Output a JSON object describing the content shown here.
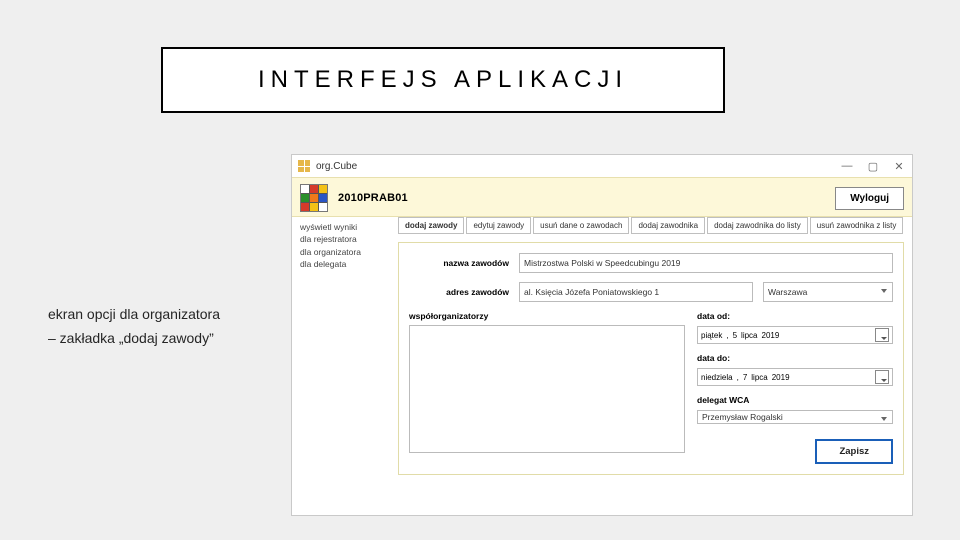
{
  "slide": {
    "title": "INTERFEJS APLIKACJI",
    "caption_line1": "ekran opcji dla organizatora",
    "caption_line2": "– zakładka „dodaj zawody”"
  },
  "app": {
    "window_title": "org.Cube",
    "competition_code": "2010PRAB01",
    "logout": "Wyloguj",
    "cube_colors": [
      "#ffffff",
      "#d63a2a",
      "#f3c116",
      "#2a8f2a",
      "#f07a1a",
      "#2a55c4",
      "#d63a2a",
      "#f3c116",
      "#ffffff"
    ]
  },
  "sidebar": {
    "items": [
      "wyświetl wyniki",
      "dla rejestratora",
      "dla organizatora",
      "dla delegata"
    ]
  },
  "tabs": [
    {
      "label": "dodaj zawody",
      "active": true
    },
    {
      "label": "edytuj zawody",
      "active": false
    },
    {
      "label": "usuń dane o zawodach",
      "active": false
    },
    {
      "label": "dodaj zawodnika",
      "active": false
    },
    {
      "label": "dodaj zawodnika do listy",
      "active": false
    },
    {
      "label": "usuń zawodnika z listy",
      "active": false
    }
  ],
  "form": {
    "name_label": "nazwa zawodów",
    "name_value": "Mistrzostwa Polski w Speedcubingu 2019",
    "addr_label": "adres zawodów",
    "addr_street": "al. Księcia Józefa Poniatowskiego 1",
    "addr_city": "Warszawa",
    "coorg_label": "współorganizatorzy",
    "date_from_label": "data od:",
    "date_from": {
      "weekday": "piątek",
      "day": "5",
      "month": "lipca",
      "year": "2019"
    },
    "date_to_label": "data do:",
    "date_to": {
      "weekday": "niedziela",
      "day": "7",
      "month": "lipca",
      "year": "2019"
    },
    "delegate_label": "delegat WCA",
    "delegate_value": "Przemysław Rogalski",
    "save": "Zapisz"
  }
}
